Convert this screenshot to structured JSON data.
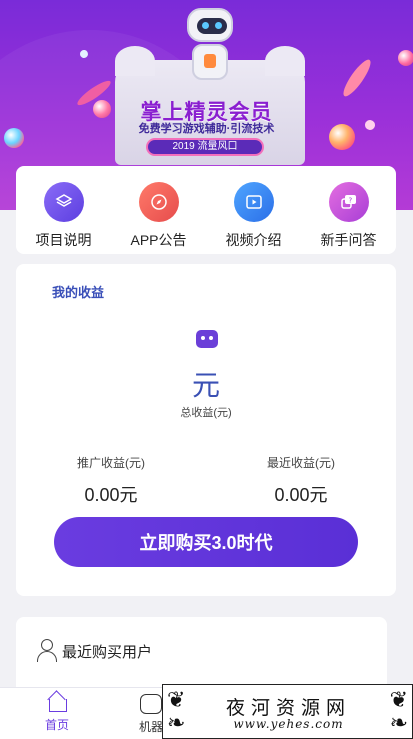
{
  "banner": {
    "title": "掌上精灵会员",
    "subtitle": "免费学习游戏辅助·引流技术",
    "tag": "2019  流量风口"
  },
  "menu": [
    {
      "label": "项目说明",
      "icon": "layers-icon"
    },
    {
      "label": "APP公告",
      "icon": "compass-icon"
    },
    {
      "label": "视频介绍",
      "icon": "video-icon"
    },
    {
      "label": "新手问答",
      "icon": "question-chat-icon"
    }
  ],
  "earnings": {
    "title": "我的收益",
    "unit": "元",
    "total_label": "总收益(元)",
    "promo_label": "推广收益(元)",
    "promo_value": "0.00元",
    "recent_label": "最近收益(元)",
    "recent_value": "0.00元",
    "buy_button": "立即购买3.0时代"
  },
  "recent_buyers": {
    "title": "最近购买用户"
  },
  "bottom_nav": [
    {
      "label": "首页",
      "icon": "home-icon",
      "active": true
    },
    {
      "label": "机器",
      "icon": "robot-icon",
      "active": false
    }
  ],
  "watermark": {
    "chinese": "夜河资源网",
    "url": "www.yehes.com"
  },
  "colors": {
    "accent": "#6a3ce0",
    "banner_top": "#7a2bd8",
    "banner_bottom": "#b43bd6",
    "title_blue": "#3a4fb8"
  }
}
